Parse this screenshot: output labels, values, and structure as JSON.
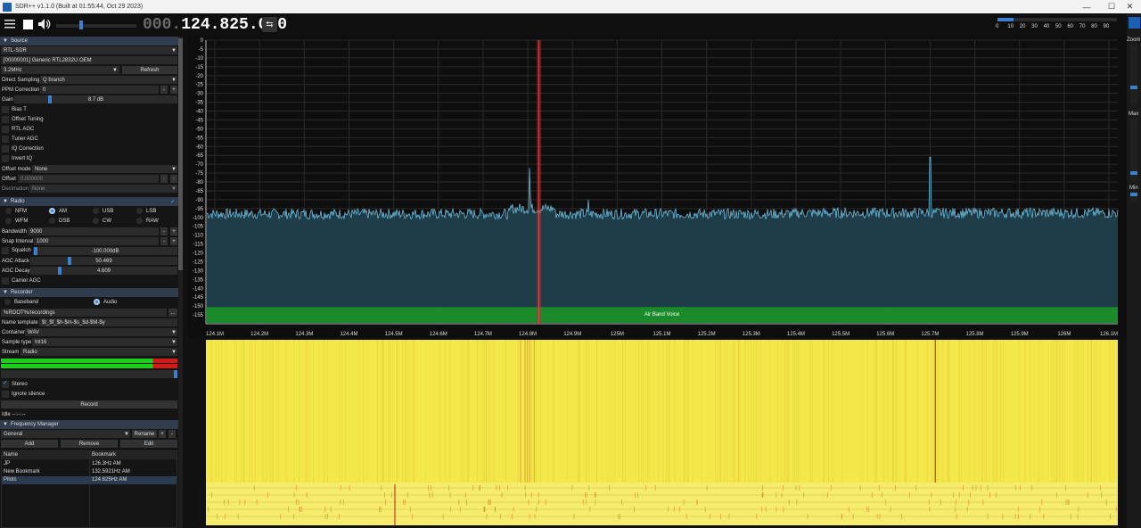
{
  "window": {
    "title": "SDR++ v1.1.0 (Built at 01:55:44, Oct 29 2023)",
    "minimize": "—",
    "maximize": "☐",
    "close": "✕"
  },
  "toolbar": {
    "freq_dim": "000.",
    "freq_main": "124.825.000",
    "swap_icon": "⇆",
    "volume_level": 0.3,
    "scale_labels": [
      "0",
      "10",
      "20",
      "30",
      "40",
      "50",
      "60",
      "70",
      "80",
      "90"
    ]
  },
  "zoom_panel": {
    "zoom_label": "Zoom",
    "max_label": "Max",
    "min_label": "Min"
  },
  "source": {
    "header": "Source",
    "type": "RTL-SDR",
    "device": "[00000001] Generic RTL2832U OEM",
    "samplerate": "3.2MHz",
    "refresh": "Refresh",
    "direct_sampling_label": "Direct Sampling",
    "direct_sampling_value": "Q branch",
    "ppm_label": "PPM Correction",
    "ppm_value": "0",
    "gain_label": "Gain",
    "gain_value": "8.7 dB",
    "checkboxes": [
      "Bias T",
      "Offset Tuning",
      "RTL AGC",
      "Tuner AGC",
      "IQ Correction",
      "Invert IQ"
    ],
    "offset_mode_label": "Offset mode",
    "offset_mode_value": "None",
    "offset_label": "Offset",
    "offset_value": "0.000000",
    "decimation_label": "Decimation",
    "decimation_value": "None"
  },
  "radio": {
    "header": "Radio",
    "modes": [
      "NFM",
      "AM",
      "USB",
      "LSB",
      "WFM",
      "DSB",
      "CW",
      "RAW"
    ],
    "selected_mode": "AM",
    "bandwidth_label": "Bandwidth",
    "bandwidth_value": "9000",
    "snap_label": "Snap Interval",
    "snap_value": "1000",
    "squelch_label": "Squelch",
    "squelch_value": "-100.000dB",
    "agc_attack_label": "AGC Attack",
    "agc_attack_value": "50.469",
    "agc_decay_label": "AGC Decay",
    "agc_decay_value": "4.609",
    "carrier_agc_label": "Carrier AGC"
  },
  "recorder": {
    "header": "Recorder",
    "baseband": "Baseband",
    "audio": "Audio",
    "path": "%ROOT%/recordings",
    "browse": "...",
    "name_template_label": "Name template",
    "name_template_value": "$t_$f_$h-$m-$s_$d-$M-$y",
    "container_label": "Container",
    "container_value": "WAV",
    "sample_type_label": "Sample type",
    "sample_type_value": "Int16",
    "stream_label": "Stream",
    "stream_value": "Radio",
    "stereo": "Stereo",
    "ignore_silence": "Ignore silence",
    "record": "Record",
    "status": "Idle --:--:--"
  },
  "freq_manager": {
    "header": "Frequency Manager",
    "list_value": "General",
    "rename": "Rename",
    "plus": "+",
    "minus": "-",
    "add": "Add",
    "remove": "Remove",
    "edit": "Edit",
    "col_name": "Name",
    "col_bookmark": "Bookmark",
    "rows": [
      {
        "name": "JP",
        "bookmark": "126.3Hz AM"
      },
      {
        "name": "New Bookmark",
        "bookmark": "132.5921Hz AM"
      },
      {
        "name": "Pilots",
        "bookmark": "124.825Hz AM"
      }
    ]
  },
  "chart_data": {
    "type": "line",
    "title": "",
    "xlabel": "",
    "ylabel": "",
    "x_ticks": [
      "124.1M",
      "124.2M",
      "124.3M",
      "124.4M",
      "124.5M",
      "124.6M",
      "124.7M",
      "124.8M",
      "124.9M",
      "125M",
      "125.1M",
      "125.2M",
      "125.3M",
      "125.4M",
      "125.5M",
      "125.6M",
      "125.7M",
      "125.8M",
      "125.9M",
      "126M",
      "126.1M"
    ],
    "y_ticks": [
      "0",
      "-5",
      "-10",
      "-15",
      "-20",
      "-25",
      "-30",
      "-35",
      "-40",
      "-45",
      "-50",
      "-55",
      "-60",
      "-65",
      "-70",
      "-75",
      "-80",
      "-85",
      "-90",
      "-95",
      "-100",
      "-105",
      "-110",
      "-115",
      "-120",
      "-125",
      "-130",
      "-135",
      "-140",
      "-145",
      "-150",
      "-155"
    ],
    "xlim_mhz": [
      124.08,
      126.12
    ],
    "ylim_db": [
      -160,
      0
    ],
    "noise_floor_db": -98,
    "peaks": [
      {
        "freq_mhz": 124.804,
        "db": -72
      },
      {
        "freq_mhz": 124.806,
        "db": -88
      },
      {
        "freq_mhz": 124.935,
        "db": -90
      },
      {
        "freq_mhz": 125.7,
        "db": -66
      }
    ],
    "band": {
      "label": "Air Band Voice",
      "from_mhz": 124.08,
      "to_mhz": 126.12
    },
    "tuned_mhz": 124.825,
    "colors": {
      "trace": "#6ab8d8",
      "fill": "#1e3d48",
      "band": "#1a8a2a",
      "vfo": "#b03a3a",
      "waterfall": "#f2e84a"
    }
  }
}
